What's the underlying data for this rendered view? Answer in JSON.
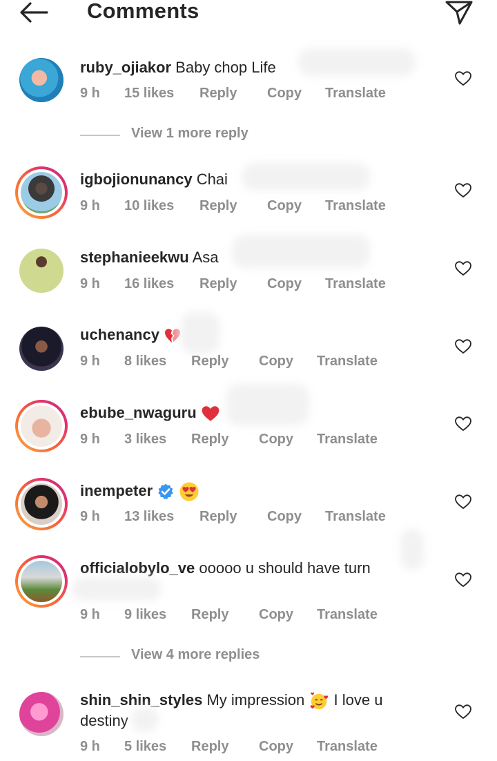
{
  "header": {
    "title": "Comments",
    "back_icon": "arrow-left-icon",
    "send_icon": "paper-plane-icon"
  },
  "colors": {
    "text": "#262626",
    "muted": "#8e8e8e",
    "heart_emoji": "#e0303c",
    "verified": "#3897f0"
  },
  "comments": [
    {
      "username": "ruby_ojiakor",
      "text": "Baby chop Life",
      "time": "9 h",
      "likes": "15 likes",
      "reply": "Reply",
      "copy": "Copy",
      "translate": "Translate",
      "view_more": "View 1 more reply"
    },
    {
      "username": "igbojionunancy",
      "text": "Chai",
      "time": "9 h",
      "likes": "10 likes",
      "reply": "Reply",
      "copy": "Copy",
      "translate": "Translate"
    },
    {
      "username": "stephanieekwu",
      "text": "Asa",
      "time": "9 h",
      "likes": "16 likes",
      "reply": "Reply",
      "copy": "Copy",
      "translate": "Translate"
    },
    {
      "username": "uchenancy",
      "text": "",
      "emoji": "broken-heart-emoji",
      "time": "9 h",
      "likes": "8 likes",
      "reply": "Reply",
      "copy": "Copy",
      "translate": "Translate"
    },
    {
      "username": "ebube_nwaguru",
      "text": "",
      "emoji": "red-heart-emoji",
      "time": "9 h",
      "likes": "3 likes",
      "reply": "Reply",
      "copy": "Copy",
      "translate": "Translate"
    },
    {
      "username": "inempeter",
      "text": "",
      "verified": true,
      "emoji": "heart-eyes-emoji",
      "time": "9 h",
      "likes": "13 likes",
      "reply": "Reply",
      "copy": "Copy",
      "translate": "Translate"
    },
    {
      "username": "officialobylo_ve",
      "text": "ooooo u should have turn",
      "time": "9 h",
      "likes": "9 likes",
      "reply": "Reply",
      "copy": "Copy",
      "translate": "Translate",
      "view_more": "View 4 more replies"
    },
    {
      "username": "shin_shin_styles",
      "text": "My impression",
      "emoji": "smiling-face-with-hearts-emoji",
      "text2": "I love u",
      "text_line2": "destiny",
      "time": "9 h",
      "likes": "5 likes",
      "reply": "Reply",
      "copy": "Copy",
      "translate": "Translate"
    }
  ]
}
